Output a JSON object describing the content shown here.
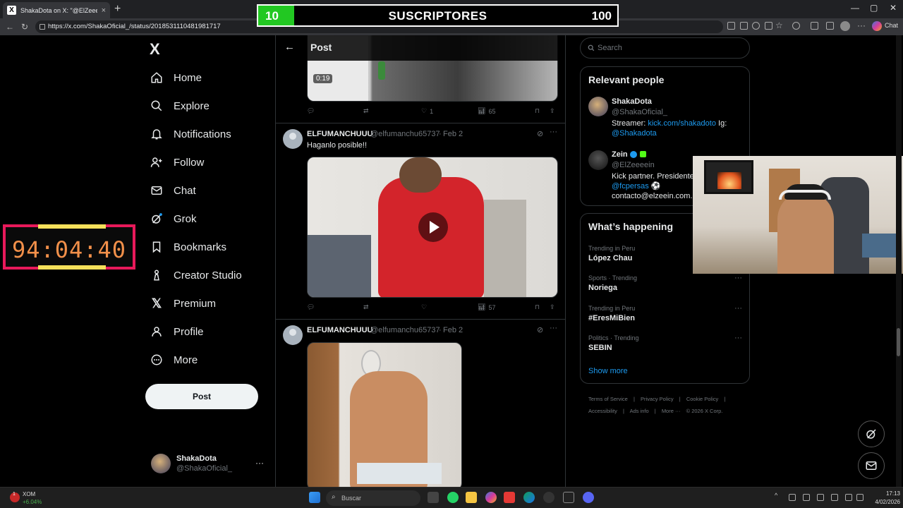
{
  "browser": {
    "tab_title": "ShakaDota on X: \"@ElZeeeein Pap",
    "tab_favicon": "X",
    "tab_close": "×",
    "new_tab": "+",
    "url": "https://x.com/ShakaOficial_/status/2018531110481981717",
    "extension_chat_label": "Chat"
  },
  "overlay": {
    "subs_current": "10",
    "subs_label": "SUSCRIPTORES",
    "subs_goal": "100",
    "subs_progress": 0.1,
    "timer": "94:04:40",
    "colors": {
      "progress": "#22c822",
      "timer_border": "#e8195a",
      "timer_text": "#f2904a",
      "timer_bar": "#f5e05a"
    }
  },
  "nav": {
    "logo": "X",
    "items": [
      {
        "label": "Home",
        "icon": "home-icon"
      },
      {
        "label": "Explore",
        "icon": "search-icon"
      },
      {
        "label": "Notifications",
        "icon": "bell-icon"
      },
      {
        "label": "Follow",
        "icon": "person-plus-icon"
      },
      {
        "label": "Chat",
        "icon": "mail-icon"
      },
      {
        "label": "Grok",
        "icon": "grok-icon"
      },
      {
        "label": "Bookmarks",
        "icon": "bookmark-icon"
      },
      {
        "label": "Creator Studio",
        "icon": "creator-studio-icon"
      },
      {
        "label": "Premium",
        "icon": "x-premium-icon"
      },
      {
        "label": "Profile",
        "icon": "person-icon"
      },
      {
        "label": "More",
        "icon": "more-circle-icon"
      }
    ],
    "post_button": "Post",
    "account": {
      "name": "ShakaDota",
      "handle": "@ShakaOficial_",
      "more": "···"
    }
  },
  "center": {
    "header_title": "Post",
    "back": "←",
    "first_tweet": {
      "video_time": "0:19",
      "likes": "1",
      "views": "65"
    },
    "tweets": [
      {
        "name": "ELFUMANCHUUU",
        "handle": "@elfumanchu65737",
        "dot": "·",
        "date": "Feb 2",
        "text": "Haganlo posible!!",
        "likes": "",
        "views": "57",
        "media": "video"
      },
      {
        "name": "ELFUMANCHUUU",
        "handle": "@elfumanchu65737",
        "dot": "·",
        "date": "Feb 2",
        "text": "",
        "media": "image"
      }
    ]
  },
  "right": {
    "search_placeholder": "Search",
    "relevant_title": "Relevant people",
    "people": [
      {
        "name": "ShakaDota",
        "handle": "@ShakaOficial_",
        "bio_prefix": "Streamer: ",
        "bio_link": "kick.com/shakadoto",
        "bio_mid": " Ig:",
        "bio_link2": "@Shakadota"
      },
      {
        "name": "Zein",
        "handle": "@ElZeeeein",
        "bio_line1": "Kick partner. Presidente",
        "bio_link": "@fcpersas",
        "bio_line3": "contacto@elzeein.com.m"
      }
    ],
    "happening_title": "What’s happening",
    "trends": [
      {
        "category": "Trending in Peru",
        "name": "López Chau"
      },
      {
        "category": "Sports · Trending",
        "name": "Noriega"
      },
      {
        "category": "Trending in Peru",
        "name": "#EresMiBien"
      },
      {
        "category": "Politics · Trending",
        "name": "SEBIN"
      }
    ],
    "show_more": "Show more",
    "footer": [
      "Terms of Service",
      "|",
      "Privacy Policy",
      "|",
      "Cookie Policy",
      "|",
      "Accessibility",
      "|",
      "Ads info",
      "|",
      "More ···",
      "© 2026 X Corp."
    ]
  },
  "taskbar": {
    "stock_name": "XOM",
    "stock_change": "+6.04%",
    "stock_badge": "1",
    "search_placeholder": "Buscar",
    "time": "17:13",
    "date": "4/02/2026"
  }
}
